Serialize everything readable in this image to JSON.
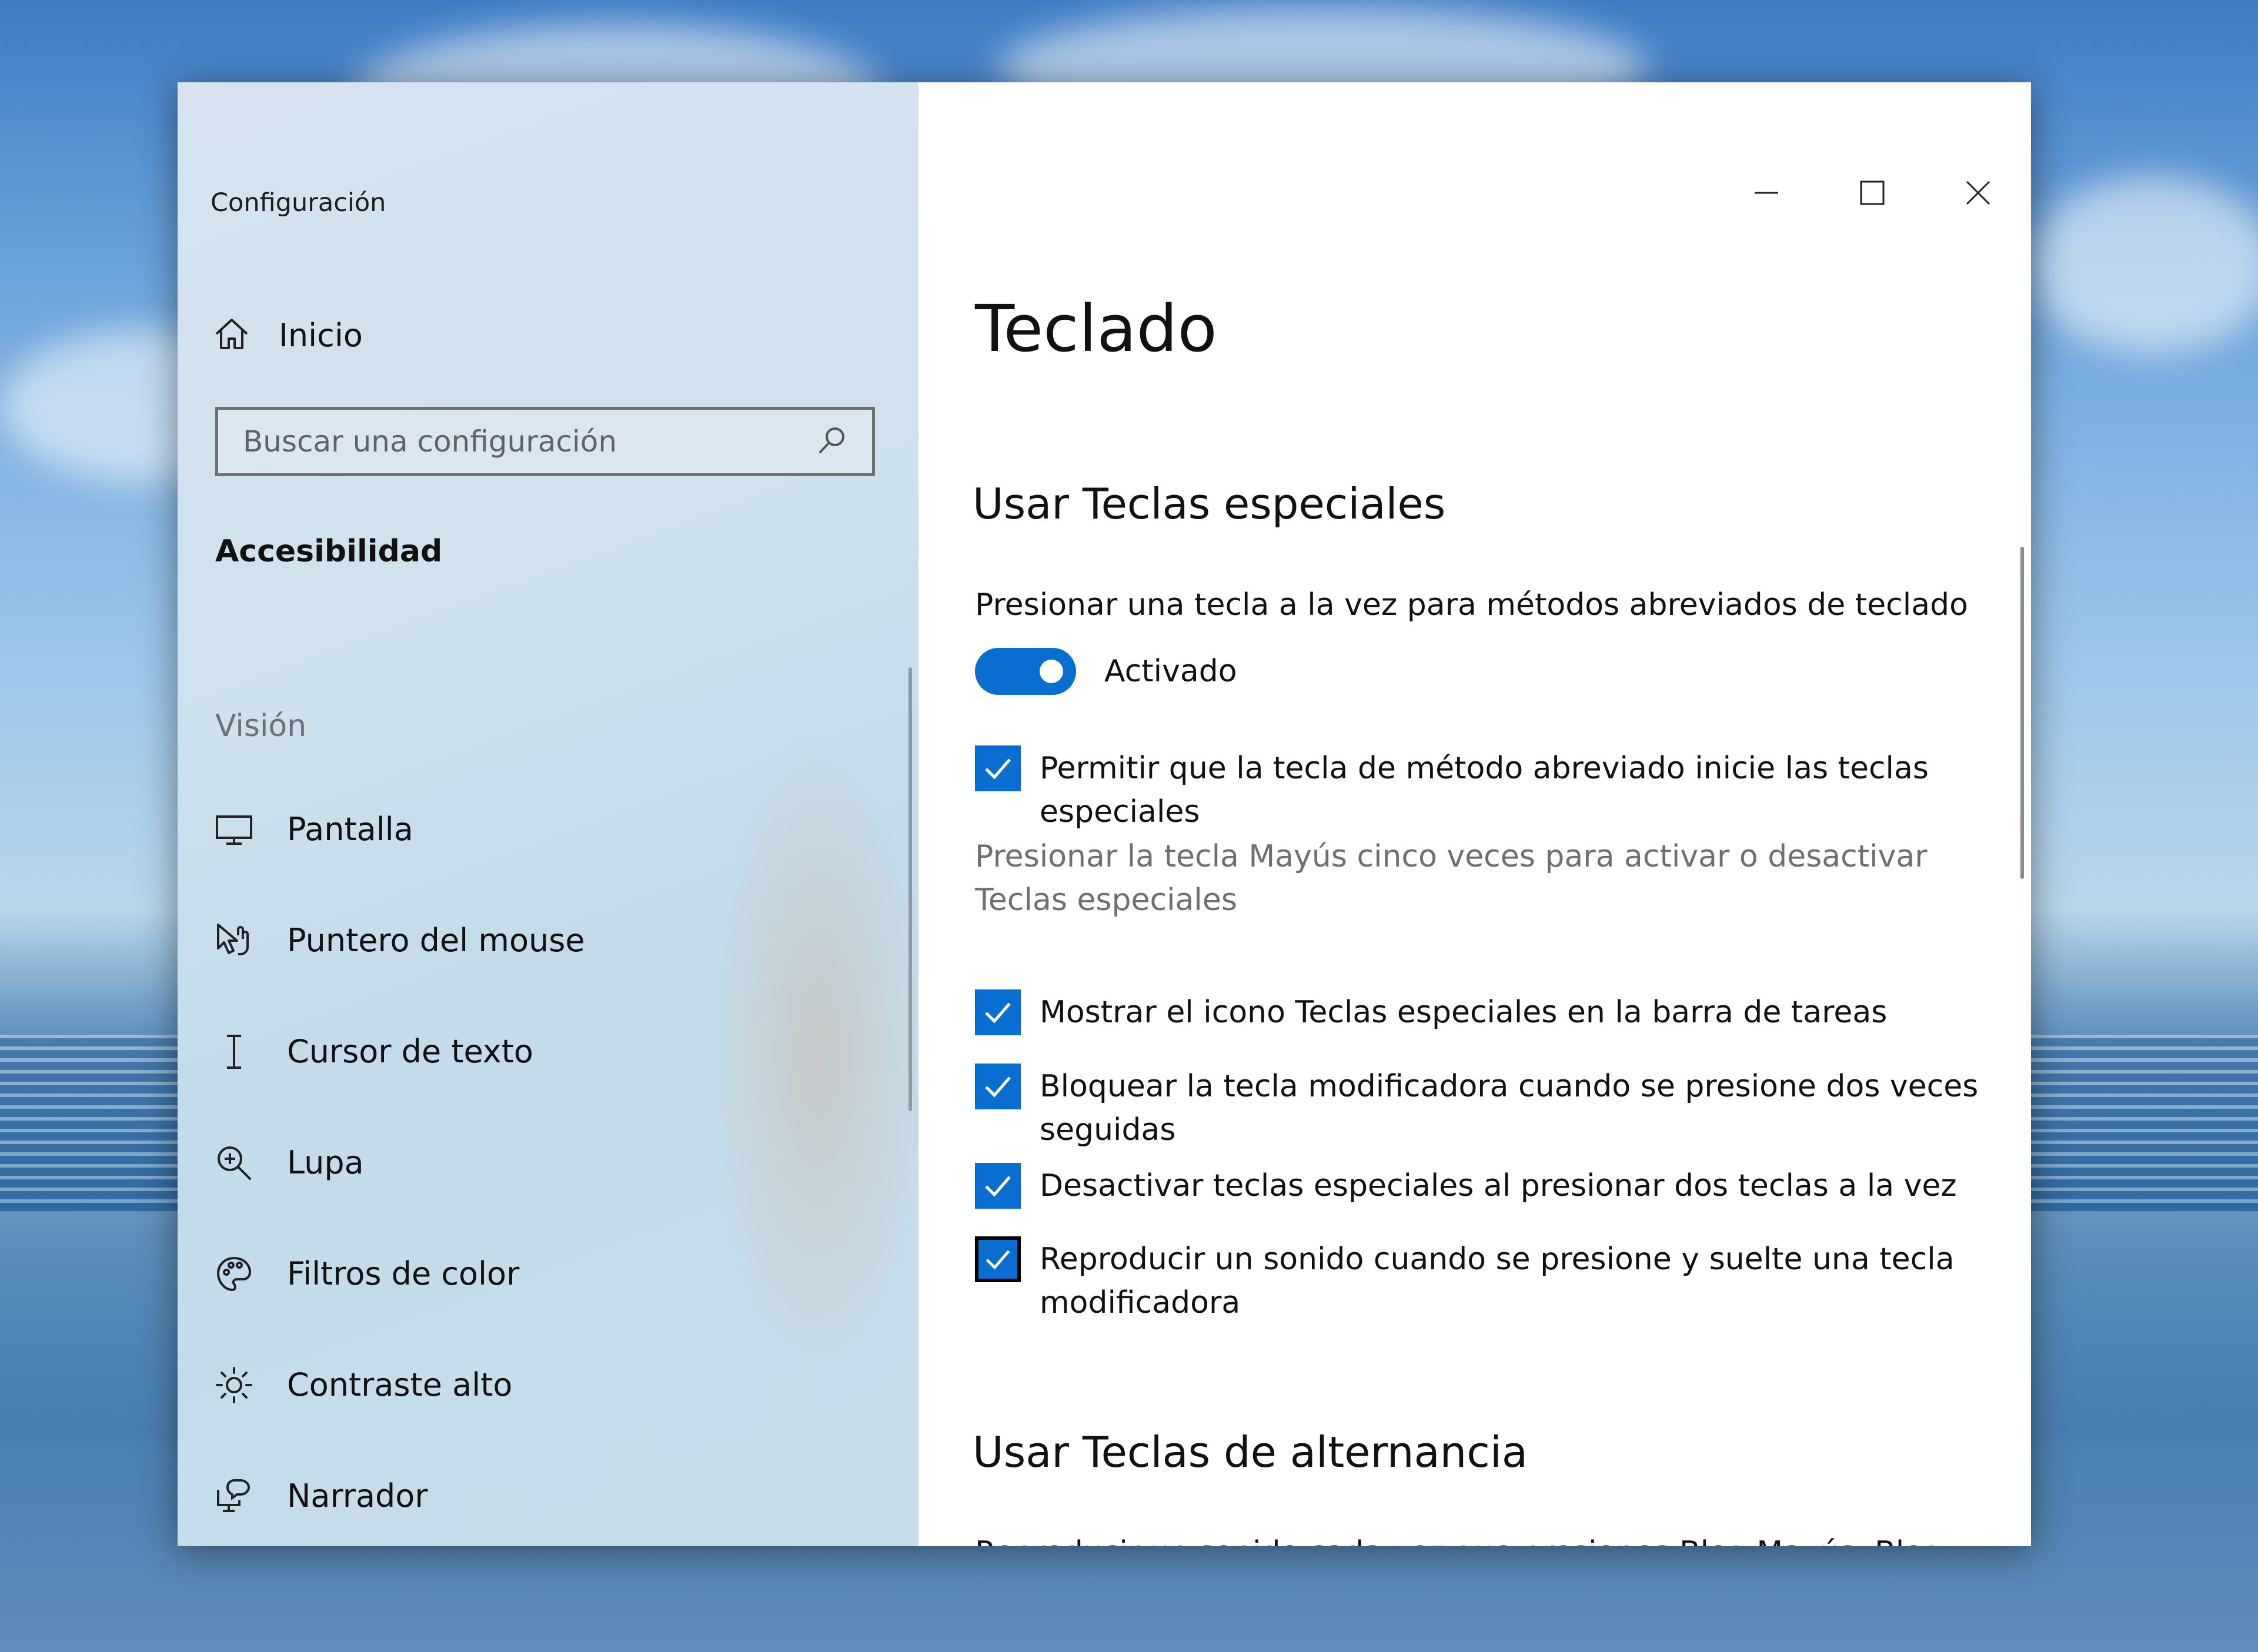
{
  "window": {
    "title": "Configuración"
  },
  "sidebar": {
    "home_label": "Inicio",
    "search_placeholder": "Buscar una configuración",
    "section_title": "Accesibilidad",
    "group_label": "Visión",
    "items": [
      {
        "label": "Pantalla",
        "icon": "monitor-icon"
      },
      {
        "label": "Puntero del mouse",
        "icon": "mouse-pointer-icon"
      },
      {
        "label": "Cursor de texto",
        "icon": "text-cursor-icon"
      },
      {
        "label": "Lupa",
        "icon": "magnifier-icon"
      },
      {
        "label": "Filtros de color",
        "icon": "palette-icon"
      },
      {
        "label": "Contraste alto",
        "icon": "sun-icon"
      },
      {
        "label": "Narrador",
        "icon": "narrator-icon"
      }
    ]
  },
  "content": {
    "page_title": "Teclado",
    "sticky_keys": {
      "heading": "Usar Teclas especiales",
      "toggle_label": "Presionar una tecla a la vez para métodos abreviados de teclado",
      "toggle_state": "Activado",
      "shortcut_option": "Permitir que la tecla de método abreviado inicie las teclas especiales",
      "shortcut_hint": "Presionar la tecla Mayús cinco veces para activar o desactivar Teclas especiales",
      "options": [
        "Mostrar el icono Teclas especiales en la barra de tareas",
        "Bloquear la tecla modificadora cuando se presione dos veces seguidas",
        "Desactivar teclas especiales al presionar dos teclas a la vez",
        "Reproducir un sonido cuando se presione y suelte una tecla modificadora"
      ]
    },
    "toggle_keys": {
      "heading": "Usar Teclas de alternancia",
      "description": "Reproducir un sonido cada vez que presiones Bloq Mayús, Bloq Num o Bloq Despl"
    }
  },
  "colors": {
    "accent": "#0a6ed1"
  }
}
